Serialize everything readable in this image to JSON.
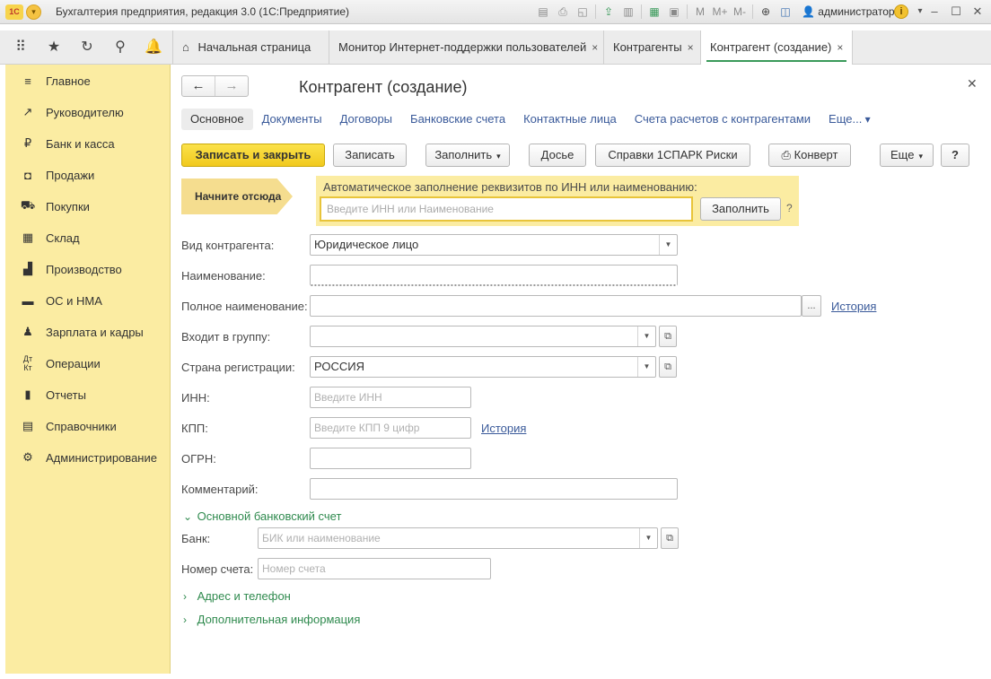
{
  "window": {
    "title": "Бухгалтерия предприятия, редакция 3.0  (1С:Предприятие)",
    "logo_text": "1С",
    "user": "администратор",
    "toolbar_letters": [
      "M",
      "M+",
      "M-"
    ]
  },
  "tabs": [
    {
      "label": "Начальная страница",
      "closable": false
    },
    {
      "label": "Монитор Интернет-поддержки пользователей",
      "closable": true
    },
    {
      "label": "Контрагенты",
      "closable": true
    },
    {
      "label": "Контрагент (создание)",
      "closable": true,
      "active": true
    }
  ],
  "tab_close_glyph": "×",
  "sidebar": {
    "items": [
      {
        "label": "Главное",
        "icon": "menu-icon"
      },
      {
        "label": "Руководителю",
        "icon": "trend-icon"
      },
      {
        "label": "Банк и касса",
        "icon": "coin-icon"
      },
      {
        "label": "Продажи",
        "icon": "bag-icon"
      },
      {
        "label": "Покупки",
        "icon": "cart-icon"
      },
      {
        "label": "Склад",
        "icon": "warehouse-icon"
      },
      {
        "label": "Производство",
        "icon": "factory-icon"
      },
      {
        "label": "ОС и НМА",
        "icon": "truck-icon"
      },
      {
        "label": "Зарплата и кадры",
        "icon": "person-icon"
      },
      {
        "label": "Операции",
        "icon": "dt-kt-icon"
      },
      {
        "label": "Отчеты",
        "icon": "bar-chart-icon"
      },
      {
        "label": "Справочники",
        "icon": "book-icon"
      },
      {
        "label": "Администрирование",
        "icon": "gear-icon"
      }
    ]
  },
  "form": {
    "title": "Контрагент (создание)",
    "links": [
      "Основное",
      "Документы",
      "Договоры",
      "Банковские счета",
      "Контактные лица",
      "Счета расчетов с контрагентами",
      "Еще..."
    ],
    "buttons": {
      "save_close": "Записать и закрыть",
      "save": "Записать",
      "fill": "Заполнить",
      "dossier": "Досье",
      "spark": "Справки 1СПАРК Риски",
      "envelope": "Конверт",
      "more": "Еще",
      "help": "?"
    },
    "start_here": "Начните отсюда",
    "autofill": {
      "label": "Автоматическое заполнение реквизитов по ИНН или наименованию:",
      "placeholder": "Введите ИНН или Наименование",
      "button": "Заполнить",
      "help": "?"
    },
    "fields": {
      "kind": {
        "label": "Вид контрагента:",
        "value": "Юридическое лицо"
      },
      "name": {
        "label": "Наименование:",
        "value": ""
      },
      "full_name": {
        "label": "Полное наименование:",
        "value": "",
        "history": "История",
        "ellipsis": "..."
      },
      "group": {
        "label": "Входит в группу:",
        "value": ""
      },
      "country": {
        "label": "Страна регистрации:",
        "value": "РОССИЯ"
      },
      "inn": {
        "label": "ИНН:",
        "placeholder": "Введите ИНН"
      },
      "kpp": {
        "label": "КПП:",
        "placeholder": "Введите КПП 9 цифр",
        "history": "История"
      },
      "ogrn": {
        "label": "ОГРН:",
        "value": ""
      },
      "comment": {
        "label": "Комментарий:",
        "value": ""
      }
    },
    "bank_group": {
      "title": "Основной банковский счет",
      "bank_label": "Банк:",
      "bank_placeholder": "БИК или наименование",
      "account_label": "Номер счета:",
      "account_placeholder": "Номер счета"
    },
    "groups_collapsed": [
      "Адрес и телефон",
      "Дополнительная информация"
    ]
  },
  "colors": {
    "sidebar_bg": "#fbeca2",
    "primary_button": "#f1c91e",
    "link": "#3a5a9a",
    "group_title": "#2f8a4e",
    "active_tab_underline": "#3a9a5a"
  }
}
